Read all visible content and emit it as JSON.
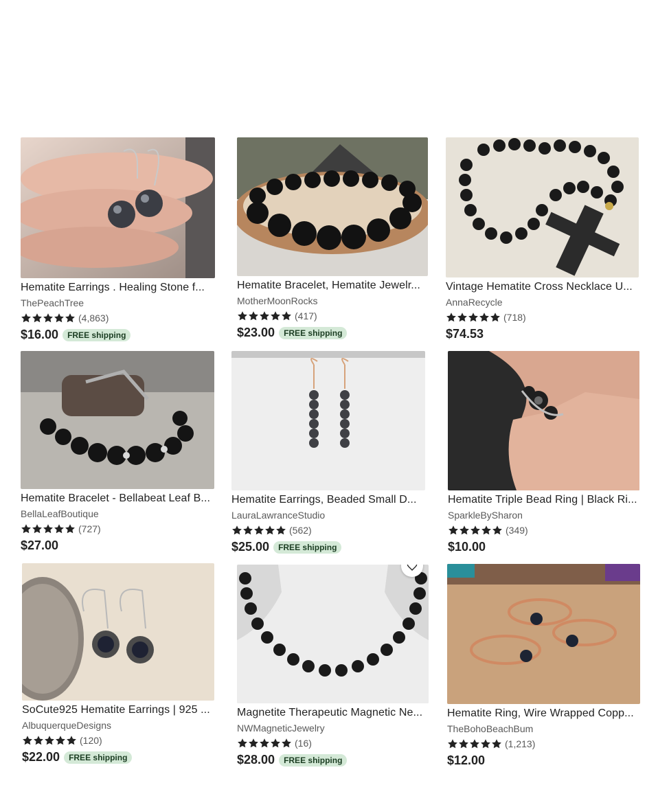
{
  "listings": [
    {
      "title": "Hematite Earrings . Healing Stone f...",
      "shop": "ThePeachTree",
      "reviews": "(4,863)",
      "price": "$16.00",
      "badge": "FREE shipping",
      "rating": 5
    },
    {
      "title": "Hematite Bracelet, Hematite Jewelr...",
      "shop": "MotherMoonRocks",
      "reviews": "(417)",
      "price": "$23.00",
      "badge": "FREE shipping",
      "rating": 5
    },
    {
      "title": "Vintage Hematite Cross Necklace U...",
      "shop": "AnnaRecycle",
      "reviews": "(718)",
      "price": "$74.53",
      "badge": "",
      "rating": 5
    },
    {
      "title": "Hematite Bracelet - Bellabeat Leaf B...",
      "shop": "BellaLeafBoutique",
      "reviews": "(727)",
      "price": "$27.00",
      "badge": "",
      "rating": 5
    },
    {
      "title": "Hematite Earrings, Beaded Small D...",
      "shop": "LauraLawranceStudio",
      "reviews": "(562)",
      "price": "$25.00",
      "badge": "FREE shipping",
      "rating": 5
    },
    {
      "title": "Hematite Triple Bead Ring | Black Ri...",
      "shop": "SparkleBySharon",
      "reviews": "(349)",
      "price": "$10.00",
      "badge": "",
      "rating": 5
    },
    {
      "title": "SoCute925 Hematite Earrings | 925 ...",
      "shop": "AlbuquerqueDesigns",
      "reviews": "(120)",
      "price": "$22.00",
      "badge": "FREE shipping",
      "rating": 5
    },
    {
      "title": "Magnetite Therapeutic Magnetic Ne...",
      "shop": "NWMagneticJewelry",
      "reviews": "(16)",
      "price": "$28.00",
      "badge": "FREE shipping",
      "rating": 5
    },
    {
      "title": "Hematite Ring, Wire Wrapped Copp...",
      "shop": "TheBohoBeachBum",
      "reviews": "(1,213)",
      "price": "$12.00",
      "badge": "",
      "rating": 5
    }
  ],
  "colors": {
    "star": "#222222",
    "badge_bg": "#d4e9d7",
    "badge_text": "#1b3d22",
    "secondary_text": "#595959"
  }
}
